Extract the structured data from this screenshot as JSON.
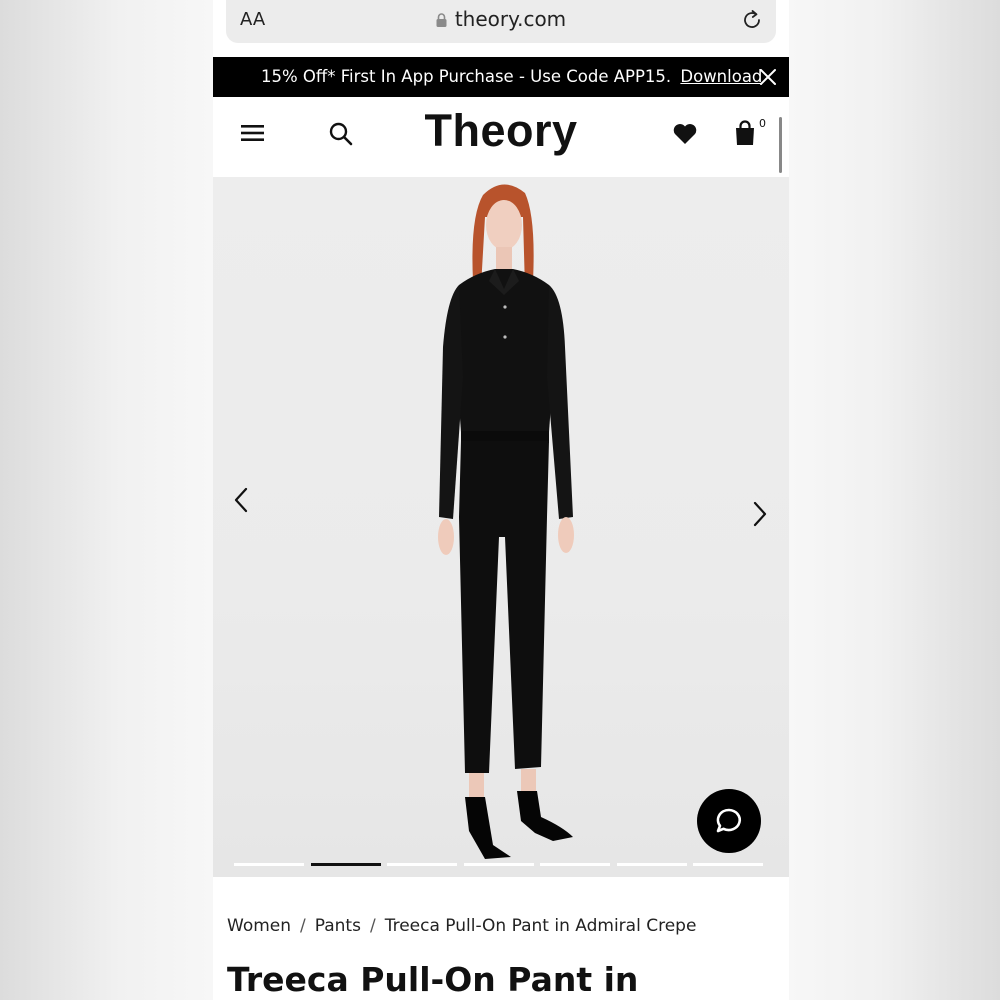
{
  "browser": {
    "text_size_label": "AA",
    "url": "theory.com"
  },
  "promo": {
    "text": "15% Off* First In App Purchase - Use Code APP15.",
    "link": "Download"
  },
  "header": {
    "logo": "Theory",
    "bag_count": "0"
  },
  "gallery": {
    "slide_count": 7,
    "active_slide": 2
  },
  "breadcrumb": {
    "items": [
      "Women",
      "Pants",
      "Treeca Pull-On Pant in Admiral Crepe"
    ]
  },
  "product": {
    "title": "Treeca Pull-On Pant in"
  },
  "colors": {
    "accent": "#000000",
    "background": "#ffffff"
  }
}
